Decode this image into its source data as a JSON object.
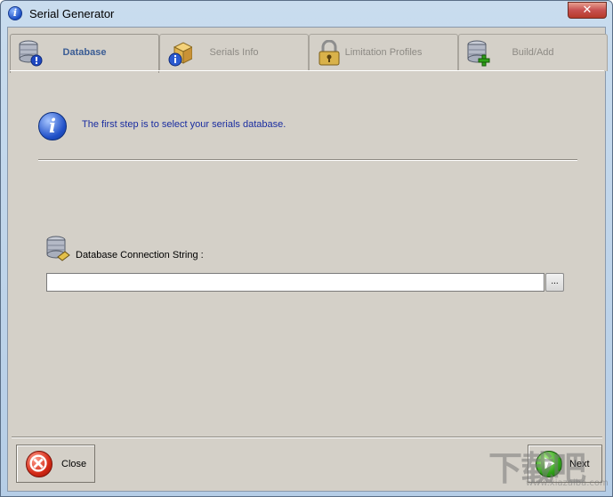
{
  "window": {
    "title": "Serial Generator",
    "close_glyph": "✕",
    "title_icon_glyph": "i"
  },
  "tabs": [
    {
      "label": "Database",
      "icon": "database-warning-icon",
      "active": true
    },
    {
      "label": "Serials Info",
      "icon": "box-info-icon",
      "active": false
    },
    {
      "label": "Limitation Profiles",
      "icon": "padlock-icon",
      "active": false
    },
    {
      "label": "Build/Add",
      "icon": "database-add-icon",
      "active": false
    }
  ],
  "info": {
    "icon_glyph": "i",
    "text": "The first step is to select your serials database."
  },
  "connection": {
    "label": "Database Connection String :",
    "value": "",
    "browse_label": "..."
  },
  "buttons": {
    "close_label": "Close",
    "next_label": "Next",
    "close_glyph": "✕",
    "next_glyph": "▶"
  },
  "watermark": {
    "main": "下载吧",
    "sub": "www.xiazaiba.com"
  },
  "colors": {
    "active_tab_text": "#3a5c94",
    "info_text": "#1a2da0",
    "client_bg": "#d4d0c8"
  }
}
